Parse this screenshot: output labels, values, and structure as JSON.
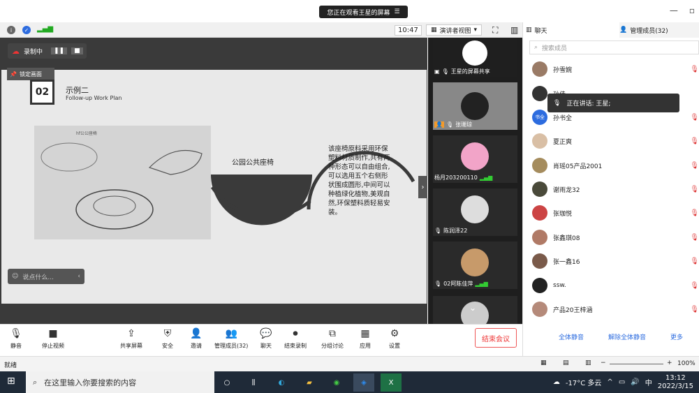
{
  "share_banner": {
    "text": "您正在观看王星的屏幕",
    "menu_icon": "menu-icon"
  },
  "toolbar": {
    "time": "10:47",
    "view_label": "演讲者视图"
  },
  "recording": {
    "label": "录制中"
  },
  "slide": {
    "lock_label": "锁定画面",
    "number": "02",
    "title": "示例二",
    "subtitle": "Follow-up Work Plan",
    "sketch_caption": "hf公公座椅",
    "product": "公园公共座椅",
    "description": "该座椅原料采用环保塑料材质制作,共有两种形态可以自由组合,可以选用五个右侧形状围成圆形,中间可以种植绿化植物,美观自然,环保塑料质轻易安装。"
  },
  "chat_input": {
    "placeholder": "说点什么..."
  },
  "video_tiles": [
    {
      "name": "王星的屏幕共享"
    },
    {
      "name": "张珊琼"
    },
    {
      "name": "杨月203200110"
    },
    {
      "name": "陈润泽22"
    },
    {
      "name": "02阿陈佳萍"
    },
    {
      "name": ""
    }
  ],
  "panel": {
    "tab_chat": "聊天",
    "tab_members": "管理成员(32)",
    "search_placeholder": "搜索成员",
    "speaking_label": "正在讲话: 王星;",
    "members": [
      "孙雪婉",
      "孙佳",
      "孙书全",
      "夏正爽",
      "肖瑶05产品2001",
      "谢雨龙32",
      "张珈悦",
      "张鑫琪08",
      "张一鑫16",
      "ssw.",
      "产品20王梓涵"
    ],
    "member_avatar_label": "书全",
    "mute_all": "全体静音",
    "unmute_all": "解除全体静音",
    "more": "更多"
  },
  "bottom_bar": {
    "mute": "静音",
    "stop_video": "停止视频",
    "share": "共享屏幕",
    "security": "安全",
    "invite": "邀请",
    "members": "管理成员(32)",
    "chat": "聊天",
    "end_record": "结束录制",
    "breakout": "分组讨论",
    "apps": "应用",
    "settings": "设置",
    "end_meeting": "结束会议"
  },
  "statusbar": {
    "ready": "就绪",
    "zoom": "100%"
  },
  "taskbar": {
    "search_placeholder": "在这里输入你要搜索的内容",
    "weather": "-17°C 多云",
    "ime": "中",
    "time": "13:12",
    "date": "2022/3/15"
  },
  "colors": {
    "accent": "#2d6cdf",
    "end_red": "#e33333",
    "taskbar": "#1f2a38"
  }
}
